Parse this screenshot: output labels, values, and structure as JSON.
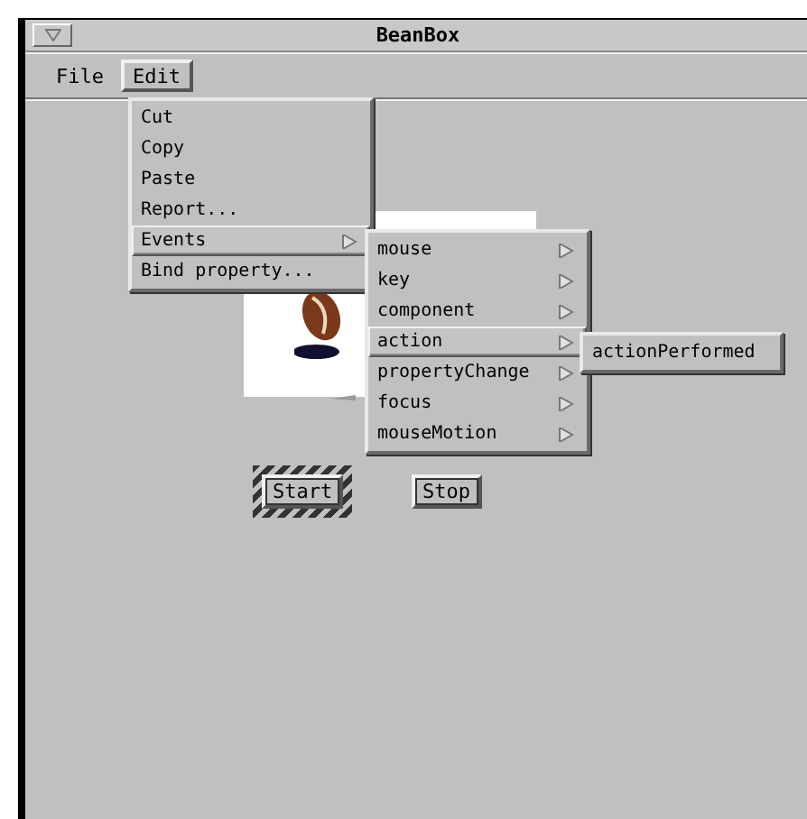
{
  "window": {
    "title": "BeanBox"
  },
  "menubar": [
    {
      "label": "File",
      "selected": false
    },
    {
      "label": "Edit",
      "selected": true
    }
  ],
  "edit_menu": [
    {
      "label": "Cut",
      "selected": false,
      "submenu": false
    },
    {
      "label": "Copy",
      "selected": false,
      "submenu": false
    },
    {
      "label": "Paste",
      "selected": false,
      "submenu": false
    },
    {
      "label": "Report...",
      "selected": false,
      "submenu": false
    },
    {
      "label": "Events",
      "selected": true,
      "submenu": true
    },
    {
      "label": "Bind property...",
      "selected": false,
      "submenu": false
    }
  ],
  "events_menu": [
    {
      "label": "mouse",
      "selected": false,
      "submenu": true
    },
    {
      "label": "key",
      "selected": false,
      "submenu": true
    },
    {
      "label": "component",
      "selected": false,
      "submenu": true
    },
    {
      "label": "action",
      "selected": true,
      "submenu": true
    },
    {
      "label": "propertyChange",
      "selected": false,
      "submenu": true
    },
    {
      "label": "focus",
      "selected": false,
      "submenu": true
    },
    {
      "label": "mouseMotion",
      "selected": false,
      "submenu": true
    }
  ],
  "action_menu": [
    {
      "label": "actionPerformed",
      "selected": false,
      "submenu": false
    }
  ],
  "beans": [
    {
      "label": "Start",
      "selected": true
    },
    {
      "label": "Stop",
      "selected": false
    }
  ]
}
